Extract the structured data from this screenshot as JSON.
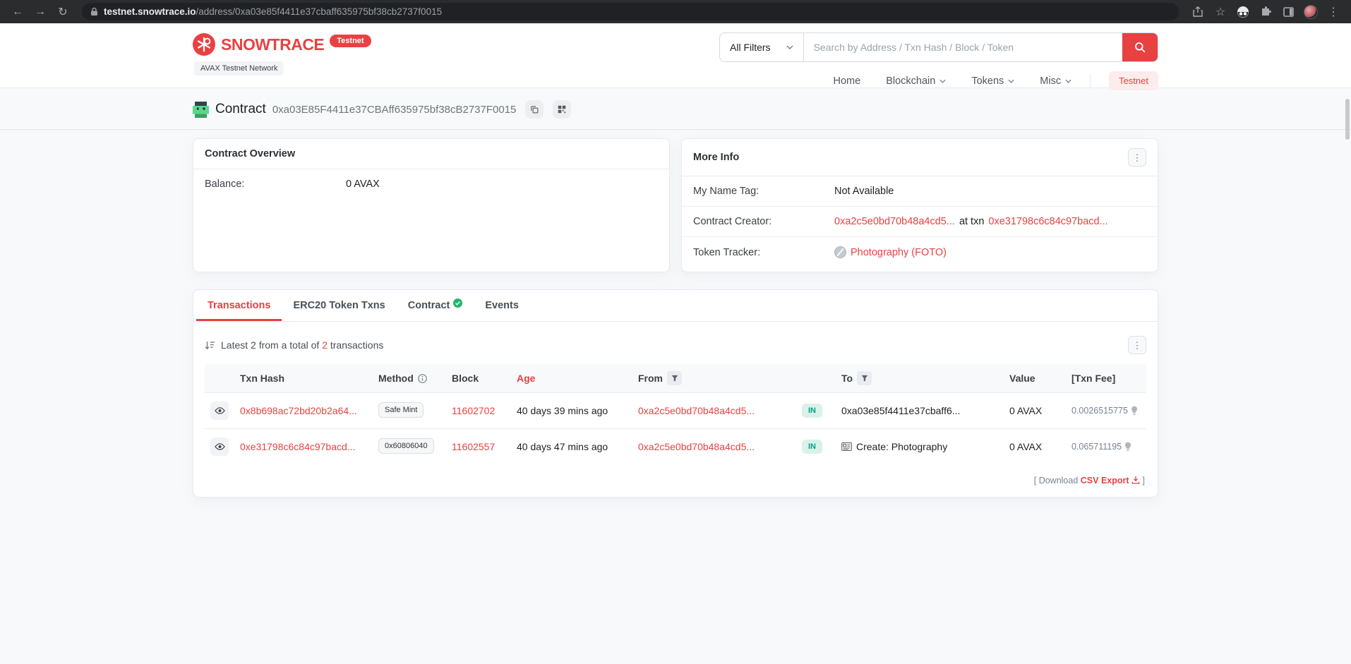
{
  "colors": {
    "brand_red": "#e84142",
    "link_red": "#e84142",
    "in_badge_green": "#00a186",
    "verified_green": "#21b66f",
    "page_bg": "#f8f9fa"
  },
  "browser": {
    "url_host": "testnet.snowtrace.io",
    "url_path": "/address/0xa03e85f4411e37cbaff635975bf38cb2737f0015"
  },
  "header": {
    "brand": "SNOWTRACE",
    "brand_badge": "Testnet",
    "network_label": "AVAX Testnet Network",
    "search": {
      "filter_label": "All Filters",
      "placeholder": "Search by Address / Txn Hash / Block / Token"
    },
    "nav": {
      "home": "Home",
      "blockchain": "Blockchain",
      "tokens": "Tokens",
      "misc": "Misc",
      "testnet_button": "Testnet"
    }
  },
  "page": {
    "title": "Contract",
    "address": "0xa03E85F4411e37CBAff635975bf38cB2737F0015",
    "overview": {
      "title": "Contract Overview",
      "balance_label": "Balance:",
      "balance_value": "0 AVAX"
    },
    "more_info": {
      "title": "More Info",
      "name_tag_label": "My Name Tag:",
      "name_tag_value": "Not Available",
      "creator_label": "Contract Creator:",
      "creator_address": "0xa2c5e0bd70b48a4cd5...",
      "creator_middle": "at txn",
      "creator_txn": "0xe31798c6c84c97bacd...",
      "tracker_label": "Token Tracker:",
      "tracker_value": "Photography (FOTO)"
    },
    "tabs": [
      {
        "label": "Transactions"
      },
      {
        "label": "ERC20 Token Txns"
      },
      {
        "label": "Contract"
      },
      {
        "label": "Events"
      }
    ],
    "transactions": {
      "summary_prefix": "Latest 2 from a total of",
      "summary_count": "2",
      "summary_suffix": "transactions",
      "columns": {
        "txn_hash": "Txn Hash",
        "method": "Method",
        "block": "Block",
        "age": "Age",
        "from": "From",
        "to": "To",
        "value": "Value",
        "txn_fee": "[Txn Fee]"
      },
      "rows": [
        {
          "hash": "0x8b698ac72bd20b2a64...",
          "method": "Safe Mint",
          "block": "11602702",
          "age": "40 days 39 mins ago",
          "from": "0xa2c5e0bd70b48a4cd5...",
          "direction": "IN",
          "to": "0xa03e85f4411e37cbaff6...",
          "value": "0 AVAX",
          "fee": "0.0026515775"
        },
        {
          "hash": "0xe31798c6c84c97bacd...",
          "method": "0x60806040",
          "block": "11602557",
          "age": "40 days 47 mins ago",
          "from": "0xa2c5e0bd70b48a4cd5...",
          "direction": "IN",
          "to": "Create: Photography",
          "value": "0 AVAX",
          "fee": "0.065711195"
        }
      ],
      "download_prefix": "[ Download",
      "download_link": "CSV Export",
      "download_suffix": "]"
    }
  }
}
